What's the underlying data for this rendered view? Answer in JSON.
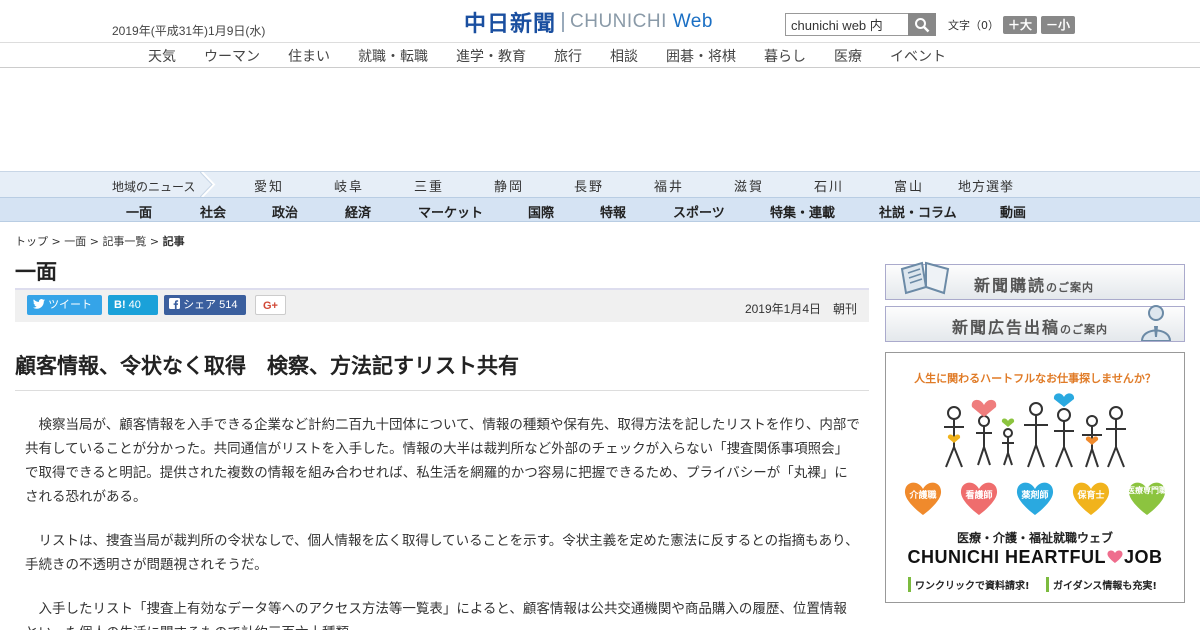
{
  "header": {
    "date": "2019年(平成31年)1月9日(水)",
    "logo_jp": "中日新聞",
    "logo_en": "CHUNICHI",
    "logo_web": "Web",
    "search_value": "chunichi web 内",
    "font_label": "文字（0）",
    "font_plus": "＋大",
    "font_minus": "－小"
  },
  "topnav": [
    "天気",
    "ウーマン",
    "住まい",
    "就職・転職",
    "進学・教育",
    "旅行",
    "相談",
    "囲碁・将棋",
    "暮らし",
    "医療",
    "イベント"
  ],
  "region": {
    "label": "地域のニュース",
    "items": [
      "愛知",
      "岐阜",
      "三重",
      "静岡",
      "長野",
      "福井",
      "滋賀",
      "石川",
      "富山",
      "地方選挙"
    ]
  },
  "categories": [
    "一面",
    "社会",
    "政治",
    "経済",
    "マーケット",
    "国際",
    "特報",
    "スポーツ",
    "特集・連載",
    "社説・コラム",
    "動画"
  ],
  "breadcrumb": {
    "top": "トップ",
    "sep1": " > ",
    "section": "一面",
    "sep2": " > ",
    "list": "記事一覧",
    "sep3": " > ",
    "current": "記事"
  },
  "section_title": "一面",
  "share": {
    "tweet": "ツイート",
    "hatena_icon": "B!",
    "hatena_count": "40",
    "facebook": "シェア",
    "facebook_count": "514",
    "gplus": "G+",
    "pubdate": "2019年1月4日　朝刊"
  },
  "article": {
    "headline": "顧客情報、令状なく取得　検察、方法記すリスト共有",
    "paragraphs": [
      "検察当局が、顧客情報を入手できる企業など計約二百九十団体について、情報の種類や保有先、取得方法を記したリストを作り、内部で共有していることが分かった。共同通信がリストを入手した。情報の大半は裁判所など外部のチェックが入らない「捜査関係事項照会」で取得できると明記。提供された複数の情報を組み合わせれば、私生活を網羅的かつ容易に把握できるため、プライバシーが「丸裸」にされる恐れがある。",
      "リストは、捜査当局が裁判所の令状なしで、個人情報を広く取得していることを示す。令状主義を定めた憲法に反するとの指摘もあり、手続きの不透明さが問題視されそうだ。",
      "入手したリスト「捜査上有効なデータ等へのアクセス方法等一覧表」によると、顧客情報は公共交通機関や商品購入の履歴、位置情報といった個人の生活に関するもので計約三百六十種類。"
    ]
  },
  "sidebar": {
    "banner1_main": "新聞購読",
    "banner1_sub": "のご案内",
    "banner2_main": "新聞広告出稿",
    "banner2_sub": "のご案内",
    "ad": {
      "tagline": "人生に関わるハートフルなお仕事探しませんか？",
      "jobs": [
        {
          "label": "介護職",
          "color": "#f08a2c"
        },
        {
          "label": "看護師",
          "color": "#ef6d6d"
        },
        {
          "label": "薬剤師",
          "color": "#2aa9e0"
        },
        {
          "label": "保育士",
          "color": "#f1b31c"
        },
        {
          "label": "医療専門職",
          "color": "#8cc43f"
        }
      ],
      "jp_title": "医療・介護・福祉就職ウェブ",
      "en_title_1": "CHUNICHI HEARTFUL",
      "en_title_2": "JOB",
      "bullet1": "ワンクリックで資料請求!",
      "bullet2": "ガイダンス情報も充実!"
    }
  }
}
